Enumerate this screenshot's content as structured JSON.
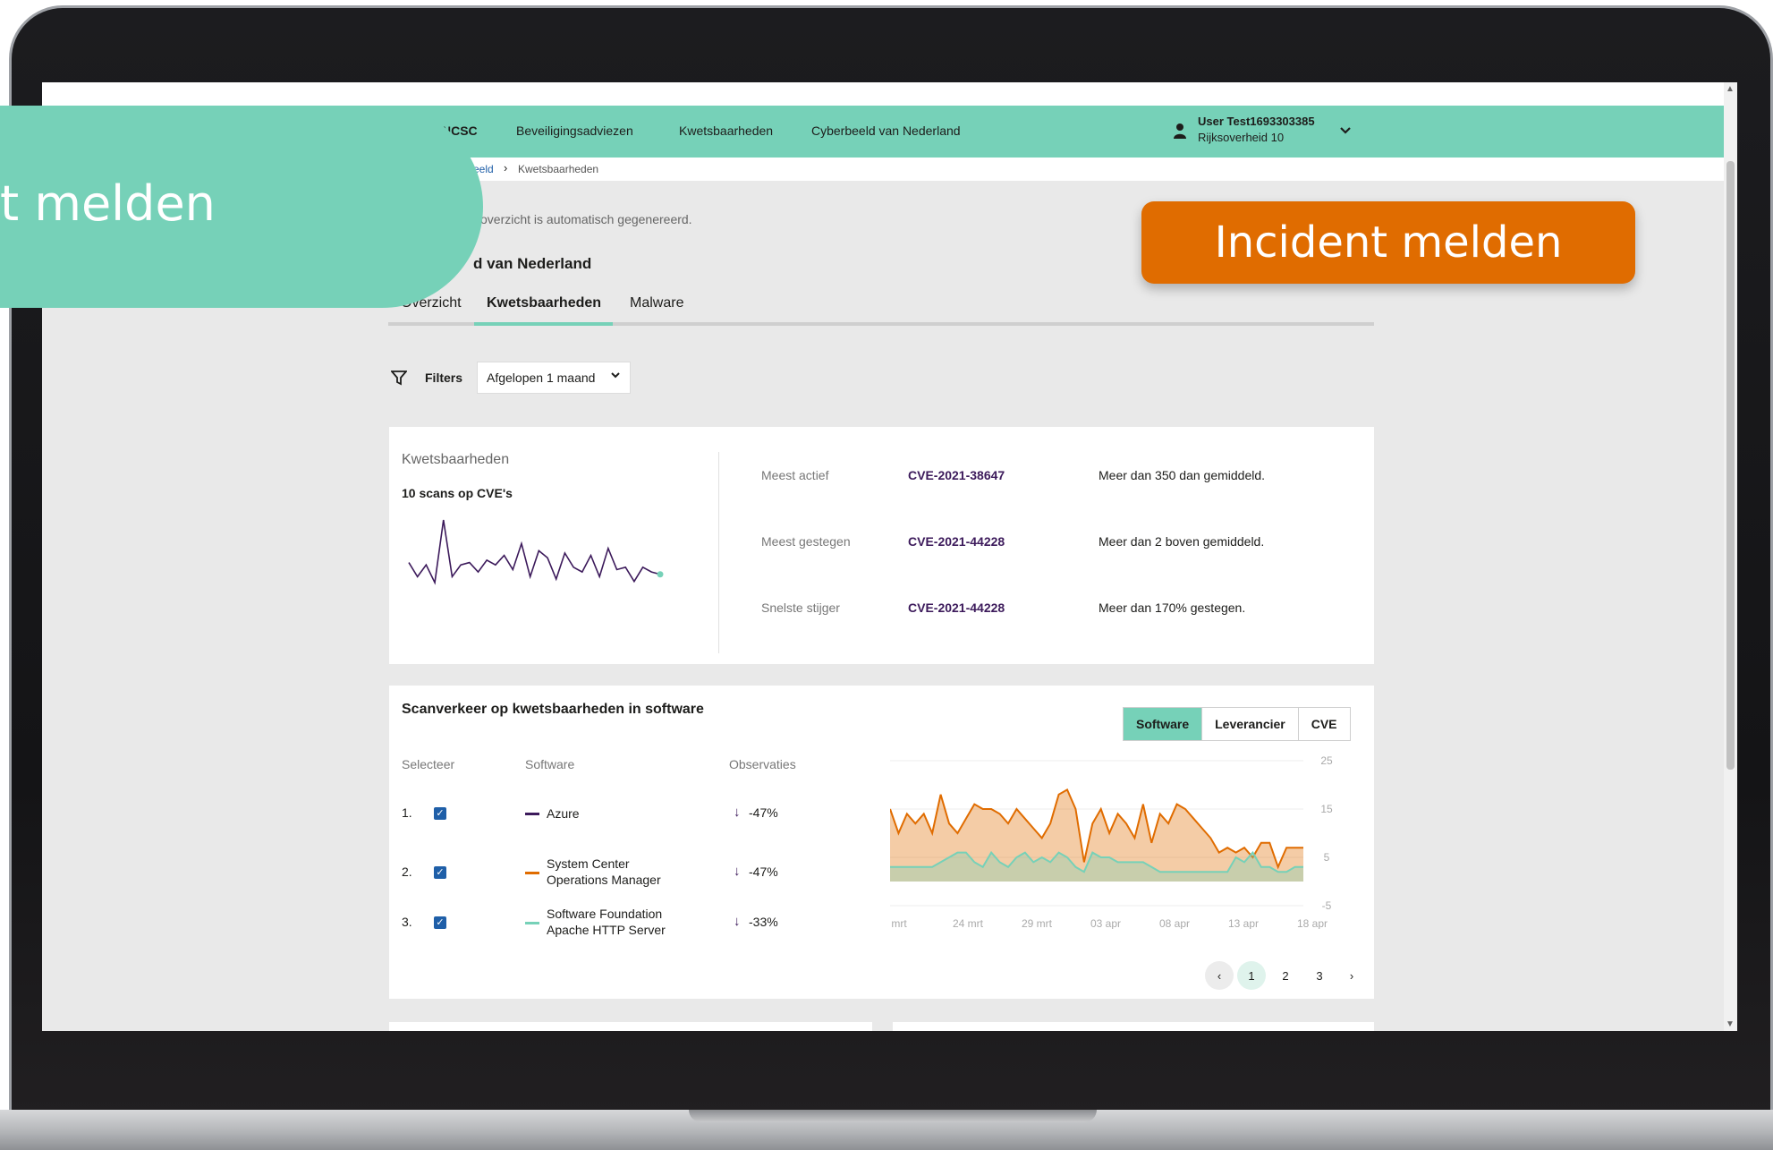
{
  "nav": {
    "brand": "NCSC",
    "links": [
      "Beveiligingsadviezen",
      "Kwetsbaarheden",
      "Cyberbeeld van Nederland"
    ],
    "user_name": "User Test1693303385",
    "user_org": "Rijksoverheid 10"
  },
  "breadcrumb": {
    "parent": "eeld",
    "separator": "›",
    "current": "Kwetsbaarheden"
  },
  "page": {
    "note": "overzicht is automatisch gegenereerd.",
    "title": "d van Nederland"
  },
  "tabs": [
    "Overzicht",
    "Kwetsbaarheden",
    "Malware"
  ],
  "filters": {
    "label": "Filters",
    "selected": "Afgelopen 1 maand"
  },
  "kwetsbaarheden": {
    "title": "Kwetsbaarheden",
    "subtitle": "10 scans op CVE's",
    "sparkline": [
      22,
      10,
      20,
      5,
      58,
      10,
      20,
      22,
      14,
      24,
      20,
      28,
      16,
      38,
      10,
      32,
      26,
      8,
      30,
      18,
      14,
      28,
      10,
      34,
      16,
      18,
      6,
      18,
      14,
      12
    ],
    "stats": [
      {
        "label": "Meest actief",
        "cve": "CVE-2021-38647",
        "desc": "Meer dan 350 dan gemiddeld."
      },
      {
        "label": "Meest gestegen",
        "cve": "CVE-2021-44228",
        "desc": "Meer dan 2 boven gemiddeld."
      },
      {
        "label": "Snelste stijger",
        "cve": "CVE-2021-44228",
        "desc": "Meer dan 170% gestegen."
      }
    ]
  },
  "scanverkeer": {
    "title": "Scanverkeer op kwetsbaarheden in software",
    "toggle": [
      "Software",
      "Leverancier",
      "CVE"
    ],
    "columns": [
      "Selecteer",
      "Software",
      "Observaties"
    ],
    "rows": [
      {
        "num": "1.",
        "name": "Azure",
        "arrow": "↓",
        "pct": "-47%",
        "color": "#3c1a5b"
      },
      {
        "num": "2.",
        "name": "System Center Operations Manager",
        "arrow": "↓",
        "pct": "-47%",
        "color": "#e06c00"
      },
      {
        "num": "3.",
        "name": "Software Foundation Apache HTTP Server",
        "arrow": "↓",
        "pct": "-33%",
        "color": "#76d1b8"
      }
    ],
    "check_mark": "✓",
    "pager": {
      "prev": "‹",
      "pages": [
        "1",
        "2",
        "3"
      ],
      "next": "›"
    }
  },
  "chart_data": {
    "type": "area",
    "x_ticks": [
      "mrt",
      "24 mrt",
      "29 mrt",
      "03 apr",
      "08 apr",
      "13 apr",
      "18 apr"
    ],
    "y_ticks": [
      "25",
      "15",
      "5",
      "-5"
    ],
    "ylim": [
      -5,
      25
    ],
    "series": [
      {
        "name": "System Center Operations Manager",
        "color": "#e06c00",
        "values": [
          15,
          10,
          14,
          12,
          14,
          10,
          18,
          12,
          10,
          13,
          16,
          15,
          15,
          14,
          12,
          15,
          13,
          11,
          9,
          12,
          18,
          19,
          15,
          4,
          12,
          15,
          10,
          14,
          12,
          9,
          16,
          8,
          14,
          12,
          16,
          15,
          13,
          11,
          9,
          6,
          7,
          6,
          7,
          5,
          8,
          8,
          3,
          7,
          7,
          7
        ]
      },
      {
        "name": "Software Foundation Apache HTTP Server",
        "color": "#76d1b8",
        "values": [
          3,
          3,
          3,
          3,
          3,
          3,
          4,
          5,
          6,
          6,
          4,
          3,
          6,
          4,
          3,
          5,
          6,
          4,
          5,
          4,
          6,
          5,
          3,
          2,
          6,
          5,
          5,
          4,
          4,
          4,
          4,
          3,
          2,
          2,
          2,
          2,
          2,
          2,
          2,
          2,
          2,
          5,
          4,
          6,
          3,
          3,
          2,
          2,
          3,
          3
        ]
      },
      {
        "name": "Azure",
        "color": "#3c1a5b",
        "values": []
      }
    ]
  },
  "incident": {
    "button": "Incident melden",
    "bubble": "t melden"
  },
  "colors": {
    "accent": "#76d1b8",
    "brand_dark": "#3c1a5b",
    "orange": "#e06c00",
    "link": "#1f5fa8"
  },
  "icons": {
    "filter": "funnel-icon",
    "user": "person-icon",
    "chevron": "chevron-down-icon"
  }
}
